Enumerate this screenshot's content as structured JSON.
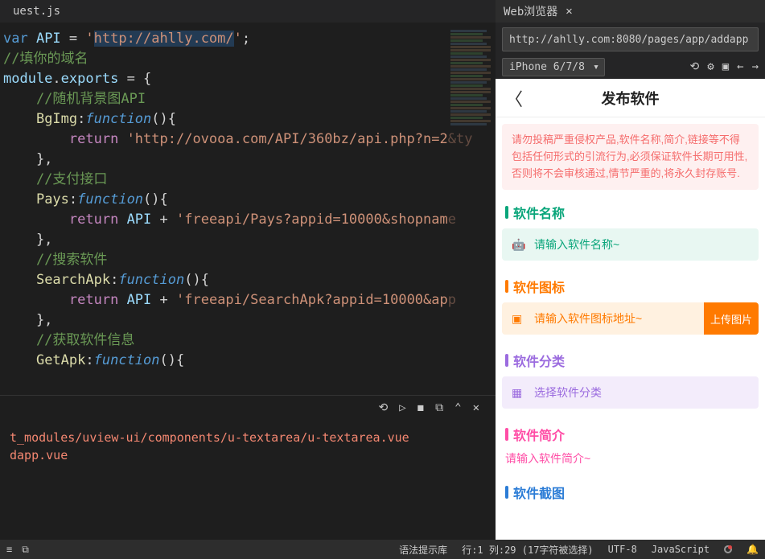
{
  "editor": {
    "tab": "uest.js",
    "lines": [
      {
        "type": "code",
        "parts": [
          {
            "t": "var ",
            "c": "kw"
          },
          {
            "t": "API",
            "c": "var"
          },
          {
            "t": " = ",
            "c": "op"
          },
          {
            "t": "'",
            "c": "str"
          },
          {
            "t": "http://ahlly.com/",
            "c": "str",
            "sel": true
          },
          {
            "t": "'",
            "c": "str"
          },
          {
            "t": ";",
            "c": "op"
          }
        ]
      },
      {
        "type": "comment",
        "text": "//填你的域名"
      },
      {
        "type": "code",
        "parts": [
          {
            "t": "module",
            "c": "var"
          },
          {
            "t": ".",
            "c": "op"
          },
          {
            "t": "exports",
            "c": "var"
          },
          {
            "t": " = {",
            "c": "op"
          }
        ]
      },
      {
        "type": "comment",
        "text": "    //随机背景图API",
        "indent": 0
      },
      {
        "type": "code",
        "parts": [
          {
            "t": "    ",
            "c": ""
          },
          {
            "t": "BgImg",
            "c": "fn"
          },
          {
            "t": ":",
            "c": "op"
          },
          {
            "t": "function",
            "c": "kw",
            "i": true
          },
          {
            "t": "(){",
            "c": "op"
          }
        ]
      },
      {
        "type": "code",
        "parts": [
          {
            "t": "        ",
            "c": ""
          },
          {
            "t": "return",
            "c": "ret"
          },
          {
            "t": " ",
            "c": ""
          },
          {
            "t": "'http://ovooa.com/API/360bz/api.php?n=2&ty",
            "c": "str"
          }
        ]
      },
      {
        "type": "code",
        "parts": [
          {
            "t": "    },",
            "c": "op"
          }
        ]
      },
      {
        "type": "comment",
        "text": "    //支付接口"
      },
      {
        "type": "code",
        "parts": [
          {
            "t": "    ",
            "c": ""
          },
          {
            "t": "Pays",
            "c": "fn"
          },
          {
            "t": ":",
            "c": "op"
          },
          {
            "t": "function",
            "c": "kw",
            "i": true
          },
          {
            "t": "(){",
            "c": "op"
          }
        ]
      },
      {
        "type": "code",
        "parts": [
          {
            "t": "        ",
            "c": ""
          },
          {
            "t": "return",
            "c": "ret"
          },
          {
            "t": " ",
            "c": ""
          },
          {
            "t": "API",
            "c": "var"
          },
          {
            "t": " + ",
            "c": "op"
          },
          {
            "t": "'freeapi/Pays?appid=10000&shopname",
            "c": "str"
          }
        ]
      },
      {
        "type": "code",
        "parts": [
          {
            "t": "    },",
            "c": "op"
          }
        ]
      },
      {
        "type": "comment",
        "text": "    //搜索软件"
      },
      {
        "type": "code",
        "parts": [
          {
            "t": "    ",
            "c": ""
          },
          {
            "t": "SearchApk",
            "c": "fn"
          },
          {
            "t": ":",
            "c": "op"
          },
          {
            "t": "function",
            "c": "kw",
            "i": true
          },
          {
            "t": "(){",
            "c": "op"
          }
        ]
      },
      {
        "type": "code",
        "parts": [
          {
            "t": "        ",
            "c": ""
          },
          {
            "t": "return",
            "c": "ret"
          },
          {
            "t": " ",
            "c": ""
          },
          {
            "t": "API",
            "c": "var"
          },
          {
            "t": " + ",
            "c": "op"
          },
          {
            "t": "'freeapi/SearchApk?appid=10000&app",
            "c": "str"
          }
        ]
      },
      {
        "type": "code",
        "parts": [
          {
            "t": "    },",
            "c": "op"
          }
        ]
      },
      {
        "type": "comment",
        "text": "    //获取软件信息"
      },
      {
        "type": "code",
        "parts": [
          {
            "t": "    ",
            "c": ""
          },
          {
            "t": "GetApk",
            "c": "fn"
          },
          {
            "t": ":",
            "c": "op"
          },
          {
            "t": "function",
            "c": "kw",
            "i": true
          },
          {
            "t": "(){",
            "c": "op"
          }
        ]
      }
    ]
  },
  "console": {
    "line1": "t_modules/uview-ui/components/u-textarea/u-textarea.vue",
    "line2": "dapp.vue"
  },
  "browser": {
    "tab_title": "Web浏览器",
    "url": "http://ahlly.com:8080/pages/app/addapp",
    "device": "iPhone 6/7/8"
  },
  "preview": {
    "page_title": "发布软件",
    "notice": "请勿投稿严重侵权产品,软件名称,简介,链接等不得包括任何形式的引流行为,必须保证软件长期可用性,否则将不会审核通过,情节严重的,将永久封存账号.",
    "sections": {
      "name": {
        "title": "软件名称",
        "placeholder": "请输入软件名称~"
      },
      "icon": {
        "title": "软件图标",
        "placeholder": "请输入软件图标地址~",
        "button": "上传图片"
      },
      "category": {
        "title": "软件分类",
        "placeholder": "选择软件分类"
      },
      "desc": {
        "title": "软件简介",
        "placeholder": "请输入软件简介~"
      },
      "screenshot": {
        "title": "软件截图"
      }
    }
  },
  "status": {
    "syntax": "语法提示库",
    "position": "行:1 列:29 (17字符被选择)",
    "encoding": "UTF-8",
    "language": "JavaScript"
  }
}
